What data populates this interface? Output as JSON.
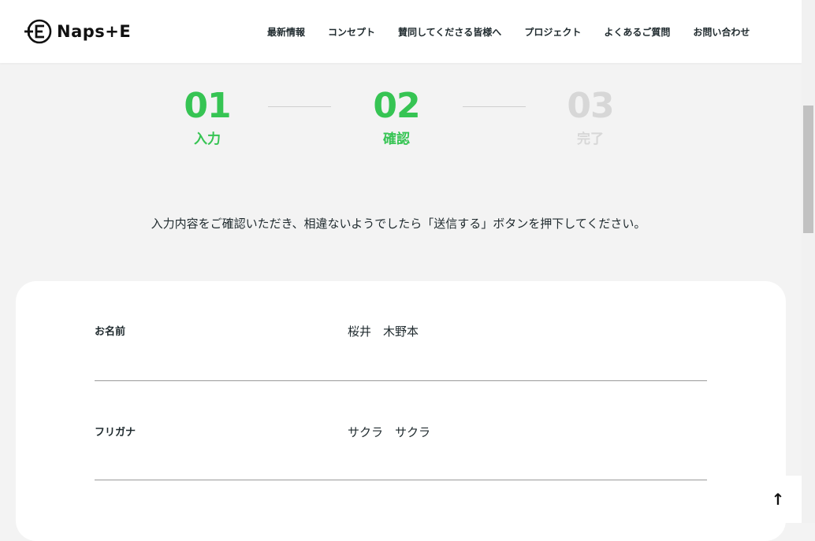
{
  "header": {
    "logo_text": "Naps+E",
    "nav": [
      "最新情報",
      "コンセプト",
      "賛同してくださる皆様へ",
      "プロジェクト",
      "よくあるご質問",
      "お問い合わせ"
    ]
  },
  "steps": [
    {
      "number": "01",
      "label": "入力",
      "state": "active"
    },
    {
      "number": "02",
      "label": "確認",
      "state": "active"
    },
    {
      "number": "03",
      "label": "完了",
      "state": "inactive"
    }
  ],
  "colors": {
    "accent": "#36c453",
    "inactive": "#d7d7d7",
    "background": "#f3f3f3"
  },
  "instruction": "入力内容をご確認いただき、相違ないようでしたら「送信する」ボタンを押下してください。",
  "form": {
    "rows": [
      {
        "label": "お名前",
        "value": "桜井　木野本"
      },
      {
        "label": "フリガナ",
        "value": "サクラ　サクラ"
      }
    ]
  },
  "to_top_icon": "arrow-up-icon",
  "to_top_glyph": "↑"
}
